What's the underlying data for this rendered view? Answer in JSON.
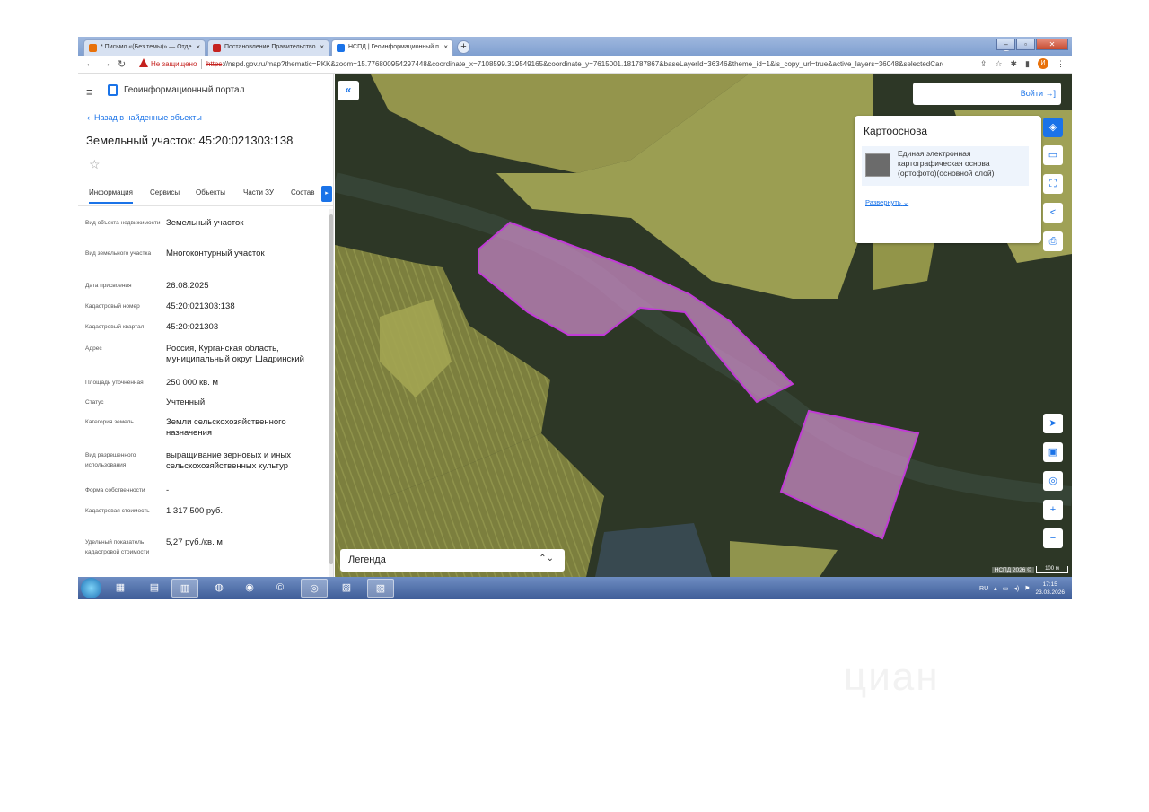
{
  "browser": {
    "tabs": [
      {
        "label": "* Письмо «(Без темы)» — Отде",
        "close": "×"
      },
      {
        "label": "Постановление Правительство",
        "close": "×"
      },
      {
        "label": "НСПД | Геоинформационный п",
        "close": "×"
      }
    ],
    "new_tab": "+",
    "security_label": "Не защищено",
    "url_scheme": "https",
    "url_rest": "://nspd.gov.ru/map?thematic=PKK&zoom=15.776800954297448&coordinate_x=7108599.319549165&coordinate_y=7615001.181787867&baseLayerId=36346&theme_id=1&is_copy_url=true&active_layers=36048&selectedCard=1...",
    "profile_initial": "И"
  },
  "header": {
    "portal_name": "Геоинформационный портал"
  },
  "panel": {
    "back_link": "Назад в найденные объекты",
    "title": "Земельный участок: 45:20:021303:138",
    "tabs": [
      "Информация",
      "Сервисы",
      "Объекты",
      "Части ЗУ",
      "Состав"
    ],
    "fields": [
      {
        "key": "Вид объекта недвижимости",
        "value": "Земельный участок"
      },
      {
        "key": "Вид земельного участка",
        "value": "Многоконтурный участок"
      },
      {
        "key": "Дата присвоения",
        "value": "26.08.2025"
      },
      {
        "key": "Кадастровый номер",
        "value": "45:20:021303:138"
      },
      {
        "key": "Кадастровый квартал",
        "value": "45:20:021303"
      },
      {
        "key": "Адрес",
        "value": "Россия, Курганская область, муниципальный округ Шадринский"
      },
      {
        "key": "Площадь уточненная",
        "value": "250 000 кв. м"
      },
      {
        "key": "Статус",
        "value": "Учтенный"
      },
      {
        "key": "Категория земель",
        "value": "Земли сельскохозяйственного назначения"
      },
      {
        "key": "Вид разрешенного использования",
        "value": "выращивание зерновых и иных сельскохозяйственных культур"
      },
      {
        "key": "Форма собственности",
        "value": "-"
      },
      {
        "key": "Кадастровая стоимость",
        "value": "1 317 500 руб."
      },
      {
        "key": "Удельный показатель кадастровой стоимости",
        "value": "5,27 руб./кв. м"
      }
    ]
  },
  "map": {
    "login": "Войти",
    "basemap": {
      "title": "Картооснова",
      "layer": "Единая электронная картографическая основа (ортофото)(основной слой)",
      "expand": "Развернуть"
    },
    "legend": "Легенда",
    "attribution": "НСПД 2026 ©",
    "scale": "100 м",
    "colors": {
      "parcel_fill": "#c889c4",
      "parcel_stroke": "#c13bd6",
      "zone_fill": "#c8c870"
    }
  },
  "taskbar": {
    "lang": "RU",
    "time": "17:15",
    "date": "23.03.2026"
  },
  "watermark": "циан"
}
